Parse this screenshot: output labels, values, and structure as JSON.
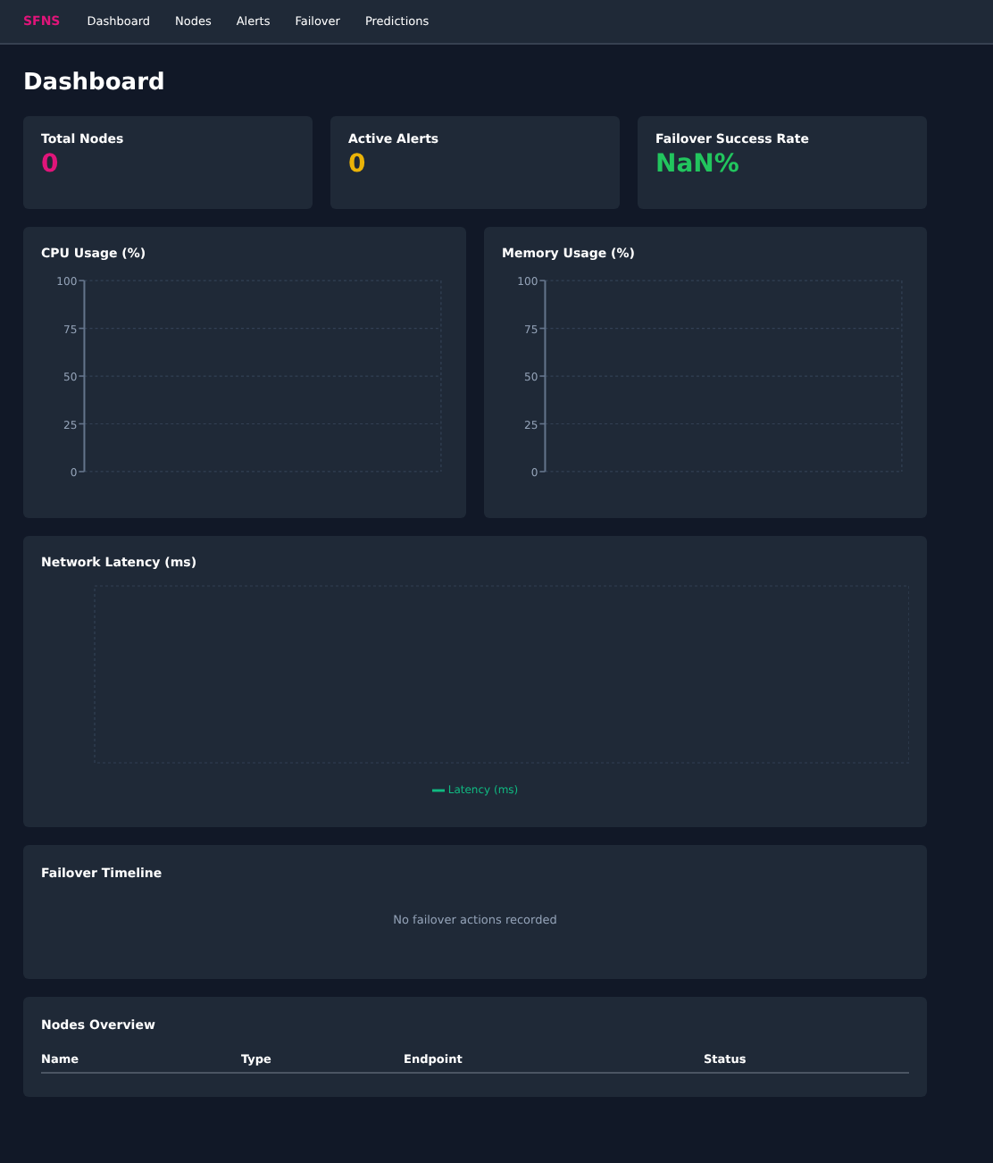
{
  "nav": {
    "brand": "SFNS",
    "links": [
      "Dashboard",
      "Nodes",
      "Alerts",
      "Failover",
      "Predictions"
    ]
  },
  "page_title": "Dashboard",
  "stats": [
    {
      "label": "Total Nodes",
      "value": "0",
      "color": "#e0157a"
    },
    {
      "label": "Active Alerts",
      "value": "0",
      "color": "#eab308"
    },
    {
      "label": "Failover Success Rate",
      "value": "NaN%",
      "color": "#22c55e"
    }
  ],
  "charts": [
    {
      "title": "CPU Usage (%)",
      "y_axis_labels": [
        "100",
        "75",
        "50",
        "25",
        "0"
      ]
    },
    {
      "title": "Memory Usage (%)",
      "y_axis_labels": [
        "100",
        "75",
        "50",
        "25",
        "0"
      ]
    }
  ],
  "latency": {
    "title": "Network Latency (ms)",
    "legend": [
      {
        "label": "Latency (ms)",
        "color": "#10b981"
      }
    ]
  },
  "failover_timeline": {
    "title": "Failover Timeline",
    "empty_message": "No failover actions recorded"
  },
  "nodes_overview": {
    "title": "Nodes Overview",
    "columns": [
      "Name",
      "Type",
      "Endpoint",
      "Status"
    ]
  }
}
